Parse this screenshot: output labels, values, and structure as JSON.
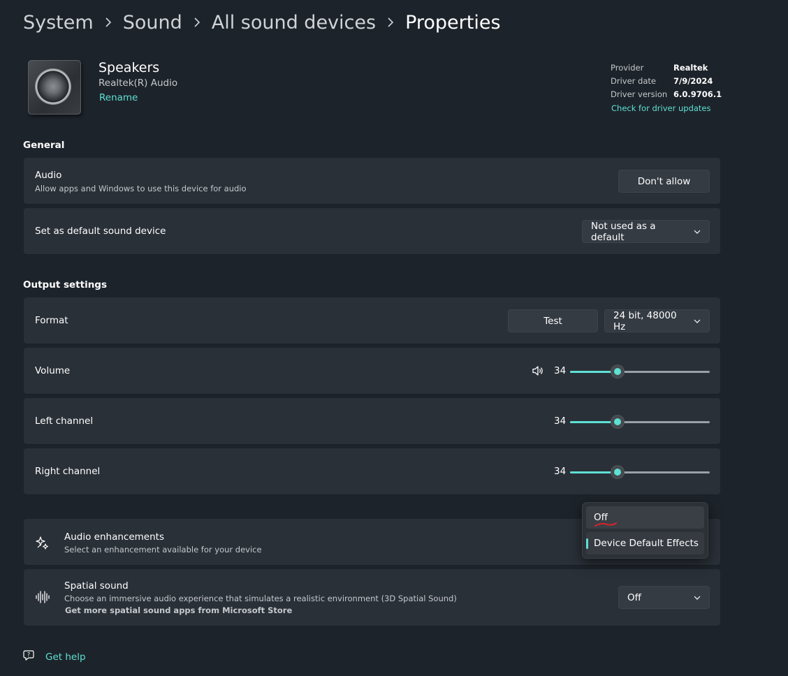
{
  "breadcrumb": [
    "System",
    "Sound",
    "All sound devices",
    "Properties"
  ],
  "device": {
    "name": "Speakers",
    "subtitle": "Realtek(R) Audio",
    "rename_label": "Rename",
    "icon": "speaker-device-icon"
  },
  "driver": {
    "provider_label": "Provider",
    "provider": "Realtek",
    "date_label": "Driver date",
    "date": "7/9/2024",
    "version_label": "Driver version",
    "version": "6.0.9706.1",
    "update_link": "Check for driver updates"
  },
  "general": {
    "title": "General",
    "audio": {
      "title": "Audio",
      "desc": "Allow apps and Windows to use this device for audio",
      "button": "Don't allow"
    },
    "default_device": {
      "title": "Set as default sound device",
      "selected": "Not used as a default"
    }
  },
  "output": {
    "title": "Output settings",
    "format": {
      "title": "Format",
      "test_button": "Test",
      "selected": "24 bit, 48000 Hz"
    },
    "volume": {
      "title": "Volume",
      "value": "34",
      "level": 0.34,
      "icon": "speaker-volume-icon"
    },
    "left": {
      "title": "Left channel",
      "value": "34",
      "level": 0.34
    },
    "right": {
      "title": "Right channel",
      "value": "34",
      "level": 0.34
    }
  },
  "enhancements": {
    "title": "Audio enhancements",
    "desc": "Select an enhancement available for your device",
    "icon": "sparkle-effects-icon",
    "menu": {
      "options": [
        "Off",
        "Device Default Effects"
      ],
      "selected": "Device Default Effects"
    }
  },
  "spatial": {
    "title": "Spatial sound",
    "desc": "Choose an immersive audio experience that simulates a realistic environment (3D Spatial Sound)",
    "link": "Get more spatial sound apps from Microsoft Store",
    "selected": "Off",
    "icon": "sound-wave-icon"
  },
  "footer": {
    "help": "Get help",
    "help_icon": "help-chat-icon"
  },
  "colors": {
    "accent": "#5ee0d4",
    "background": "#1d232a",
    "card": "#2a3038",
    "annotation": "#e0202a"
  }
}
